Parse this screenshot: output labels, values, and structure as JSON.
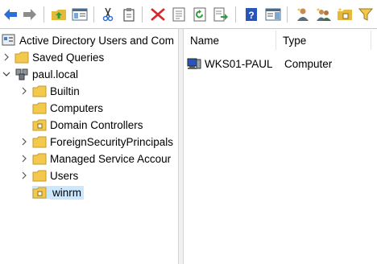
{
  "tree": {
    "root_label": "Active Directory Users and Com",
    "items": [
      {
        "label": "Saved Queries",
        "expander": "collapsed"
      },
      {
        "label": "paul.local",
        "expander": "expanded"
      },
      {
        "label": "Builtin",
        "expander": "collapsed"
      },
      {
        "label": "Computers",
        "expander": "none"
      },
      {
        "label": "Domain Controllers",
        "expander": "none"
      },
      {
        "label": "ForeignSecurityPrincipals",
        "expander": "collapsed"
      },
      {
        "label": "Managed Service Accour",
        "expander": "collapsed"
      },
      {
        "label": "Users",
        "expander": "collapsed"
      },
      {
        "label": "winrm",
        "expander": "none",
        "selected": true
      }
    ]
  },
  "list": {
    "columns": [
      "Name",
      "Type"
    ],
    "rows": [
      {
        "name": "WKS01-PAUL",
        "type": "Computer"
      }
    ]
  },
  "colors": {
    "selection": "#cce8ff",
    "folder": "#f2c94c",
    "arrow_blue": "#2a6fd6"
  }
}
